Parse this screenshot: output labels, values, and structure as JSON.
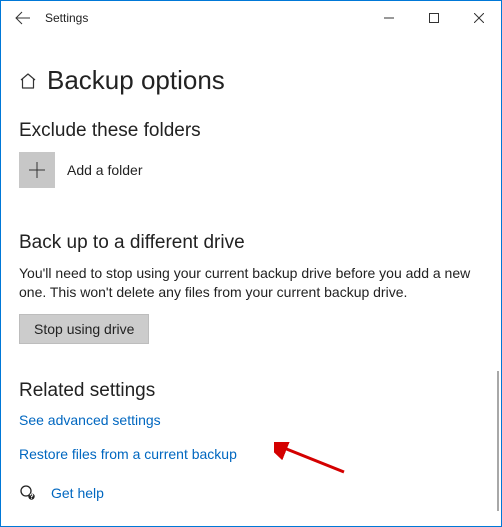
{
  "titlebar": {
    "title": "Settings"
  },
  "page": {
    "heading": "Backup options"
  },
  "exclude": {
    "heading": "Exclude these folders",
    "add_label": "Add a folder"
  },
  "backup": {
    "heading": "Back up to a different drive",
    "desc": "You'll need to stop using your current backup drive before you add a new one. This won't delete any files from your current backup drive.",
    "stop_btn": "Stop using drive"
  },
  "related": {
    "heading": "Related settings",
    "advanced_link": "See advanced settings",
    "restore_link": "Restore files from a current backup"
  },
  "help": {
    "label": "Get help"
  }
}
